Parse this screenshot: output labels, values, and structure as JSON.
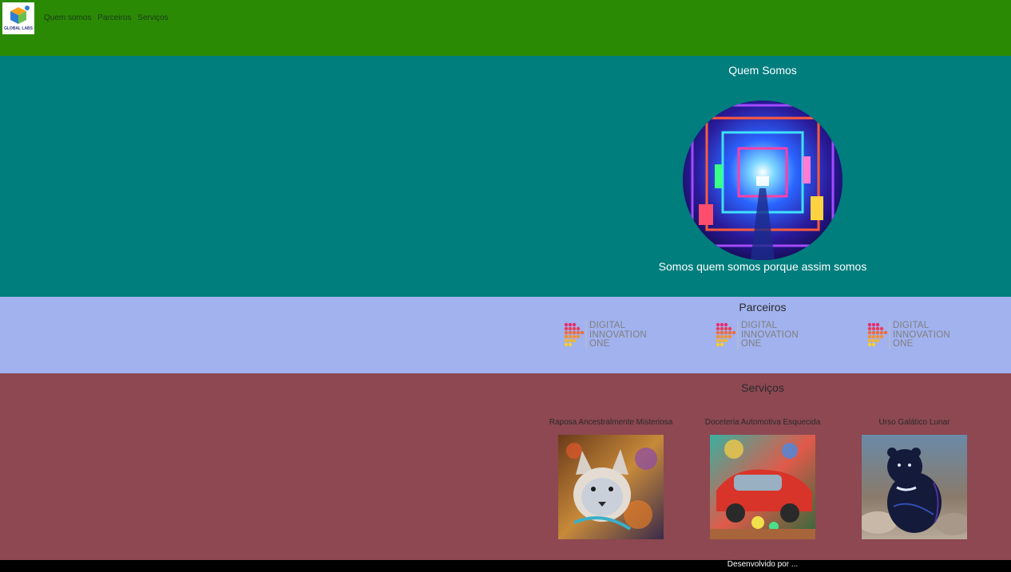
{
  "header": {
    "logo_text": "GLOBAL LABS",
    "nav": [
      "Quem somos",
      "Parceiros",
      "Serviços"
    ]
  },
  "quem_somos": {
    "title": "Quem Somos",
    "text": "Somos quem somos porque assim somos"
  },
  "parceiros": {
    "title": "Parceiros",
    "logo_lines": [
      "DIGITAL",
      "INNOVATION",
      "ONE"
    ]
  },
  "servicos": {
    "title": "Serviços",
    "items": [
      {
        "caption": "Raposa Ancestralmente Misteriosa"
      },
      {
        "caption": "Doceteria Automotiva Esquecida"
      },
      {
        "caption": "Urso Galático Lunar"
      }
    ]
  },
  "footer": {
    "text": "Desenvolvido por ..."
  },
  "colors": {
    "header": "#2b8a04",
    "quem_somos": "#007d7d",
    "parceiros": "#a1b2ee",
    "servicos": "#8d4852",
    "footer": "#000000"
  }
}
